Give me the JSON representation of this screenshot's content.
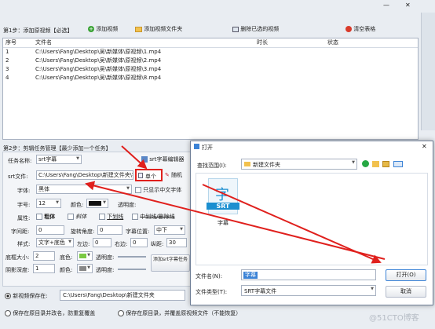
{
  "window_controls": {
    "minimize": "—",
    "close": "✕"
  },
  "step1": {
    "label": "第1步：添加原视频【必选】",
    "add_video": "添加视频",
    "add_folder": "添加视频文件夹",
    "delete_selected": "删除已选的视频",
    "clear_table": "清空表格",
    "columns": [
      "序号",
      "文件名",
      "时长",
      "状态"
    ],
    "rows": [
      {
        "no": "1",
        "file": "C:\\Users\\Fang\\Desktop\\吴\\新媒体\\原视频\\1.mp4"
      },
      {
        "no": "2",
        "file": "C:\\Users\\Fang\\Desktop\\吴\\新媒体\\原视频\\2.mp4"
      },
      {
        "no": "3",
        "file": "C:\\Users\\Fang\\Desktop\\吴\\新媒体\\原视频\\3.mp4"
      },
      {
        "no": "4",
        "file": "C:\\Users\\Fang\\Desktop\\吴\\新媒体\\原视频\\8.mp4"
      }
    ]
  },
  "step2": {
    "label": "第2步：剪辑任务管理【最少添加一个任务】",
    "task_name_label": "任务名称:",
    "task_name_value": "srt字幕",
    "srt_editor": "srt字幕编辑器",
    "srt_file_label": "srt文件:",
    "srt_file_value": "C:\\Users\\Fang\\Desktop\\新建文件夹\\字",
    "single_button": "单个",
    "random_button": "随机",
    "font_label": "字体:",
    "font_value": "黑体",
    "only_chinese": "只显示中文字体",
    "size_label": "字号:",
    "size_value": "12",
    "color_label": "颜色:",
    "opacity_label": "透明度:",
    "attr_label": "属性:",
    "bold": "粗体",
    "italic": "斜体",
    "underline": "下划线",
    "strike": "中划线/删除线",
    "spacing_label": "字间距:",
    "spacing_value": "0",
    "rotate_label": "旋转角度:",
    "rotate_value": "0",
    "position_label": "字幕位置:",
    "position_value": "中下",
    "style_label": "样式:",
    "style_value": "文字+底色",
    "left_label": "左边:",
    "left_value": "0",
    "right_label": "右边:",
    "right_value": "0",
    "bottom_label": "纵距:",
    "bottom_value": "30",
    "bg_size_label": "底框大小:",
    "bg_size_value": "2",
    "bg_color_label": "底色:",
    "bg_opacity_label": "透明度:",
    "shadow_label": "阴影深度:",
    "shadow_value": "1",
    "shadow_color_label": "颜色:",
    "shadow_opacity_label": "透明度:",
    "add_task_button": "添加srt字幕任务"
  },
  "output": {
    "new_save_label": "新视频保存在:",
    "new_save_value": "C:\\Users\\Fang\\Desktop\\新建文件夹",
    "opt_rename": "保存在原目录并改名，防重复覆盖",
    "opt_overwrite": "保存在原目录，并覆盖原视频文件（不能恢复）"
  },
  "dialog": {
    "title": "打开",
    "lookin_label": "查找范围(I):",
    "lookin_value": "新建文件夹",
    "file_icon_char": "字",
    "file_badge": "SRT",
    "file_name": "字幕",
    "filename_label": "文件名(N):",
    "filename_value": "字幕",
    "filetype_label": "文件类型(T):",
    "filetype_value": "SRT字幕文件",
    "open_button": "打开(O)",
    "cancel_button": "取消",
    "close": "✕"
  },
  "watermark": "@51CTO博客",
  "colors": {
    "accent_red": "#e0201d",
    "srt_blue": "#1b8fd0",
    "dialog_select": "#cce4f7"
  }
}
